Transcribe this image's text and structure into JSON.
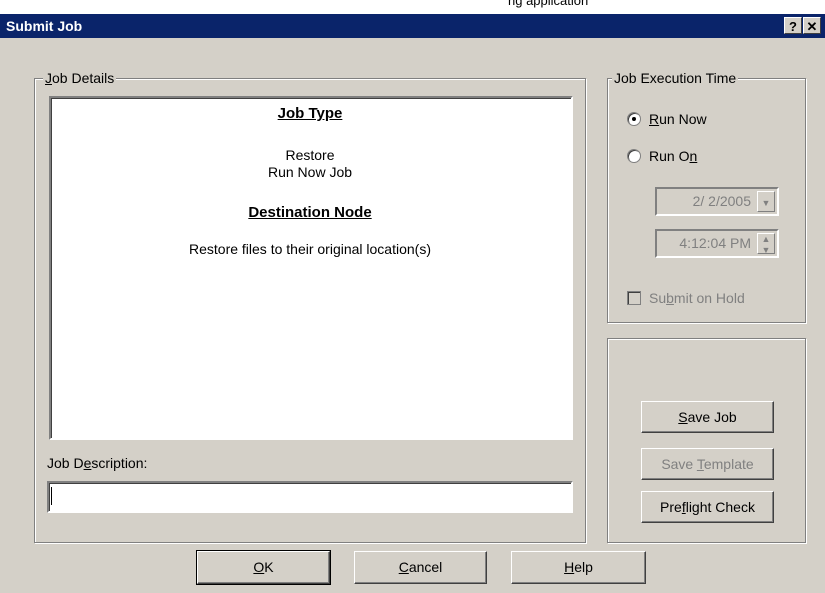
{
  "top_strip_text": "ng application",
  "window": {
    "title": "Submit Job",
    "help_button": "?",
    "close_button": "✕"
  },
  "job_details": {
    "legend": "Job Details",
    "job_type_heading": "Job Type",
    "job_type_line1": "Restore",
    "job_type_line2": "Run Now Job",
    "destination_heading": "Destination Node",
    "destination_text": "Restore files to their original location(s)"
  },
  "job_description": {
    "label": "Job Description:",
    "value": ""
  },
  "execution_time": {
    "legend": "Job Execution Time",
    "run_now_label": "Run Now",
    "run_on_label": "Run On",
    "selected": "run_now",
    "date_value": "2/ 2/2005",
    "time_value": "4:12:04 PM",
    "submit_on_hold_label": "Submit on Hold",
    "submit_on_hold_checked": false
  },
  "side_buttons": {
    "save_job": "Save Job",
    "save_template": "Save Template",
    "preflight_check": "Preflight Check"
  },
  "footer_buttons": {
    "ok": "OK",
    "cancel": "Cancel",
    "help": "Help"
  }
}
